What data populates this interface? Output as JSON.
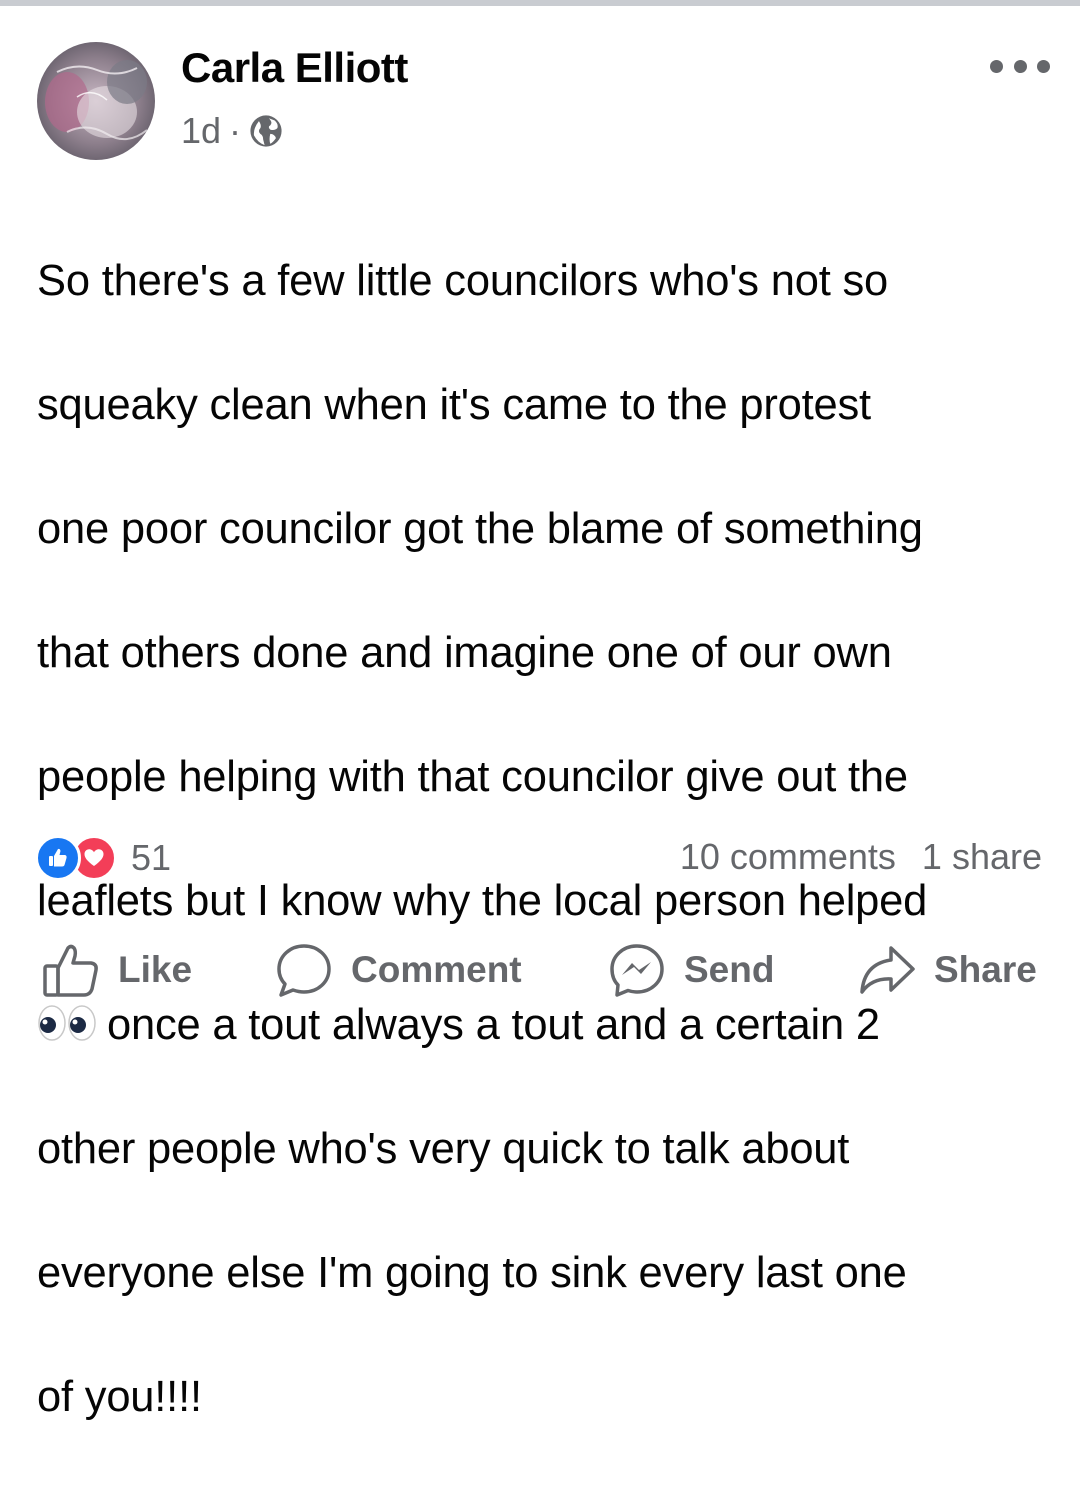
{
  "post": {
    "author": "Carla Elliott",
    "time": "1d",
    "separator": "·",
    "audience_icon": "globe-icon",
    "body_lines": [
      "So there's a few little councilors who's not so",
      "squeaky clean when it's came to the protest",
      "one poor councilor got the blame of something",
      "that others done and imagine one of our own",
      "people helping with that councilor give out the",
      "leaflets but I know why the local person helped",
      "once a tout always a tout and a certain 2",
      "other people who's very quick to talk about",
      "everyone else I'm going to sink every last one",
      "of you!!!!"
    ],
    "emoji": "eyes-emoji"
  },
  "engagement": {
    "reactions_count": "51",
    "comments": "10 comments",
    "shares": "1 share"
  },
  "actions": {
    "like": "Like",
    "comment": "Comment",
    "send": "Send",
    "share": "Share"
  },
  "colors": {
    "like_blue": "#1877f2",
    "love_red": "#f33e58",
    "secondary_text": "#65676b"
  }
}
